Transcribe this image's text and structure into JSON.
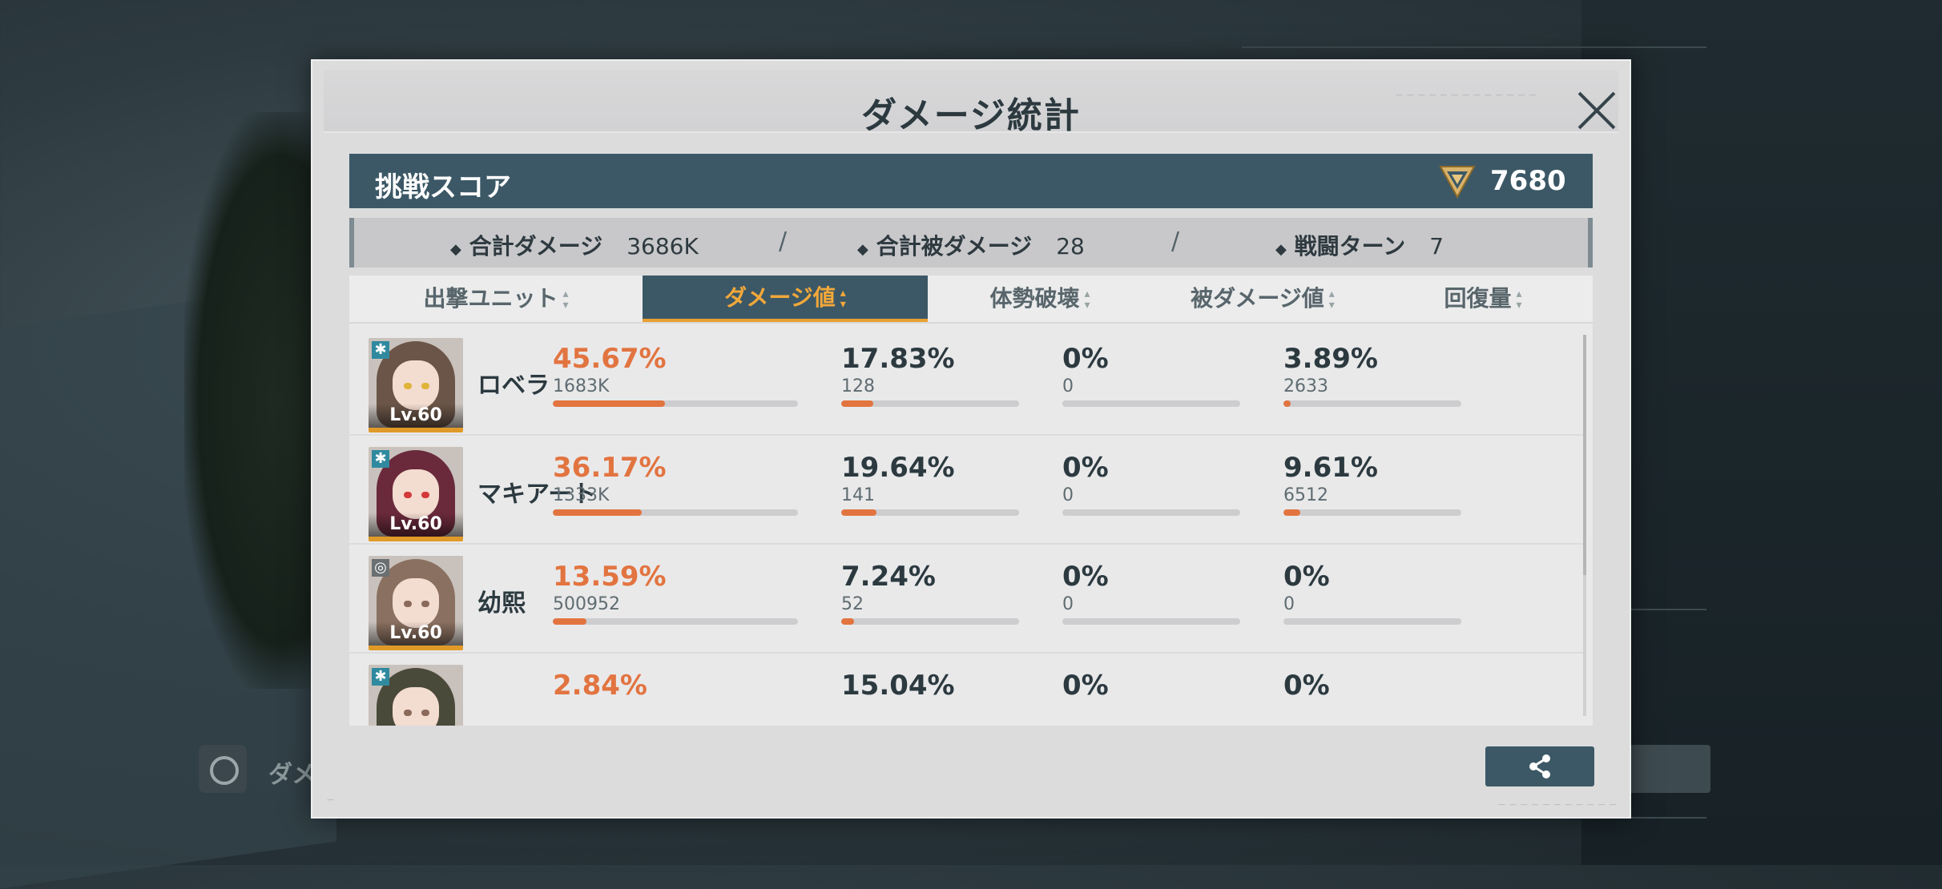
{
  "background": {
    "bg_label": "ダメ"
  },
  "modal": {
    "title": "ダメージ統計",
    "score": {
      "label": "挑戦スコア",
      "value": "7680"
    },
    "summary": [
      {
        "label": "合計ダメージ",
        "value": "3686K"
      },
      {
        "label": "合計被ダメージ",
        "value": "28"
      },
      {
        "label": "戦闘ターン",
        "value": "7"
      }
    ],
    "separator": "/",
    "diamond": "◆",
    "columns": [
      "出撃ユニット",
      "ダメージ値",
      "体勢破壊",
      "被ダメージ値",
      "回復量"
    ],
    "active_column": "ダメージ値",
    "rows": [
      {
        "name": "ロベラ",
        "level": "Lv.60",
        "element_icon": "snowflake-icon",
        "damage_pct": "45.67%",
        "damage_raw": "1683K",
        "damage_frac": 0.4567,
        "break_pct": "17.83%",
        "break_raw": "128",
        "break_frac": 0.1783,
        "taken_pct": "0%",
        "taken_raw": "0",
        "taken_frac": 0,
        "heal_pct": "3.89%",
        "heal_raw": "2633",
        "heal_frac": 0.0389
      },
      {
        "name": "マキアート",
        "level": "Lv.60",
        "element_icon": "snowflake-icon",
        "damage_pct": "36.17%",
        "damage_raw": "1333K",
        "damage_frac": 0.3617,
        "break_pct": "19.64%",
        "break_raw": "141",
        "break_frac": 0.1964,
        "taken_pct": "0%",
        "taken_raw": "0",
        "taken_frac": 0,
        "heal_pct": "9.61%",
        "heal_raw": "6512",
        "heal_frac": 0.0961
      },
      {
        "name": "幼熙",
        "level": "Lv.60",
        "element_icon": "camera-icon",
        "damage_pct": "13.59%",
        "damage_raw": "500952",
        "damage_frac": 0.1359,
        "break_pct": "7.24%",
        "break_raw": "52",
        "break_frac": 0.0724,
        "taken_pct": "0%",
        "taken_raw": "0",
        "taken_frac": 0,
        "heal_pct": "0%",
        "heal_raw": "0",
        "heal_frac": 0
      },
      {
        "name": "",
        "level": "",
        "element_icon": "snowflake-icon",
        "damage_pct": "2.84%",
        "damage_raw": "",
        "damage_frac": 0.0284,
        "break_pct": "15.04%",
        "break_raw": "",
        "break_frac": 0.1504,
        "taken_pct": "0%",
        "taken_raw": "",
        "taken_frac": 0,
        "heal_pct": "0%",
        "heal_raw": "",
        "heal_frac": 0
      }
    ],
    "colors": {
      "accent": "#3c5866",
      "highlight": "#f2a83a",
      "bar": "#e2743f"
    }
  }
}
